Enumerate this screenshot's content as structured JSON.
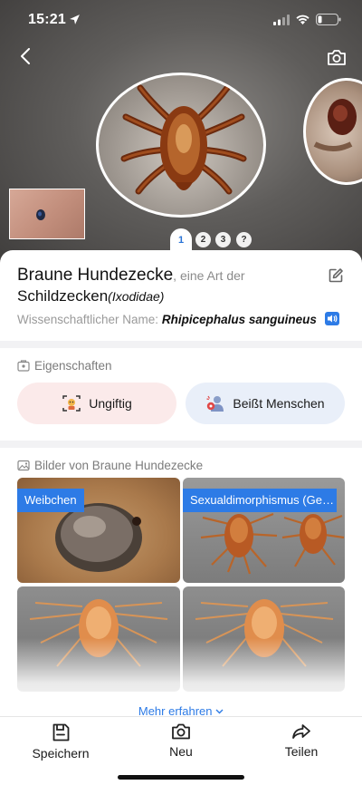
{
  "status_bar": {
    "time": "15:21"
  },
  "hero": {
    "pager": [
      "1",
      "2",
      "3",
      "?"
    ],
    "active_page": 0
  },
  "species": {
    "name": "Braune Hundezecke",
    "rest_text": ", eine Art der",
    "family": "Schildzecken",
    "family_latin": "(Ixodidae)",
    "sci_label": "Wissenschaftlicher Name:",
    "sci_name": "Rhipicephalus sanguineus"
  },
  "properties": {
    "title": "Eigenschaften",
    "items": [
      {
        "label": "Ungiftig",
        "icon": "non-toxic-icon",
        "color": "#fbeaea"
      },
      {
        "label": "Beißt Menschen",
        "icon": "bites-humans-icon",
        "color": "#e9eff9"
      }
    ]
  },
  "images": {
    "title": "Bilder von Braune Hundezecke",
    "tiles": [
      {
        "badge": "Weibchen"
      },
      {
        "badge": "Sexualdimorphismus (Ge…"
      },
      {
        "badge": ""
      },
      {
        "badge": ""
      }
    ],
    "more_label": "Mehr erfahren"
  },
  "bottom_nav": {
    "save": "Speichern",
    "new": "Neu",
    "share": "Teilen"
  },
  "colors": {
    "accent": "#2d7be6",
    "non_toxic_bg": "#fbeaea",
    "bites_bg": "#e9eff9"
  }
}
